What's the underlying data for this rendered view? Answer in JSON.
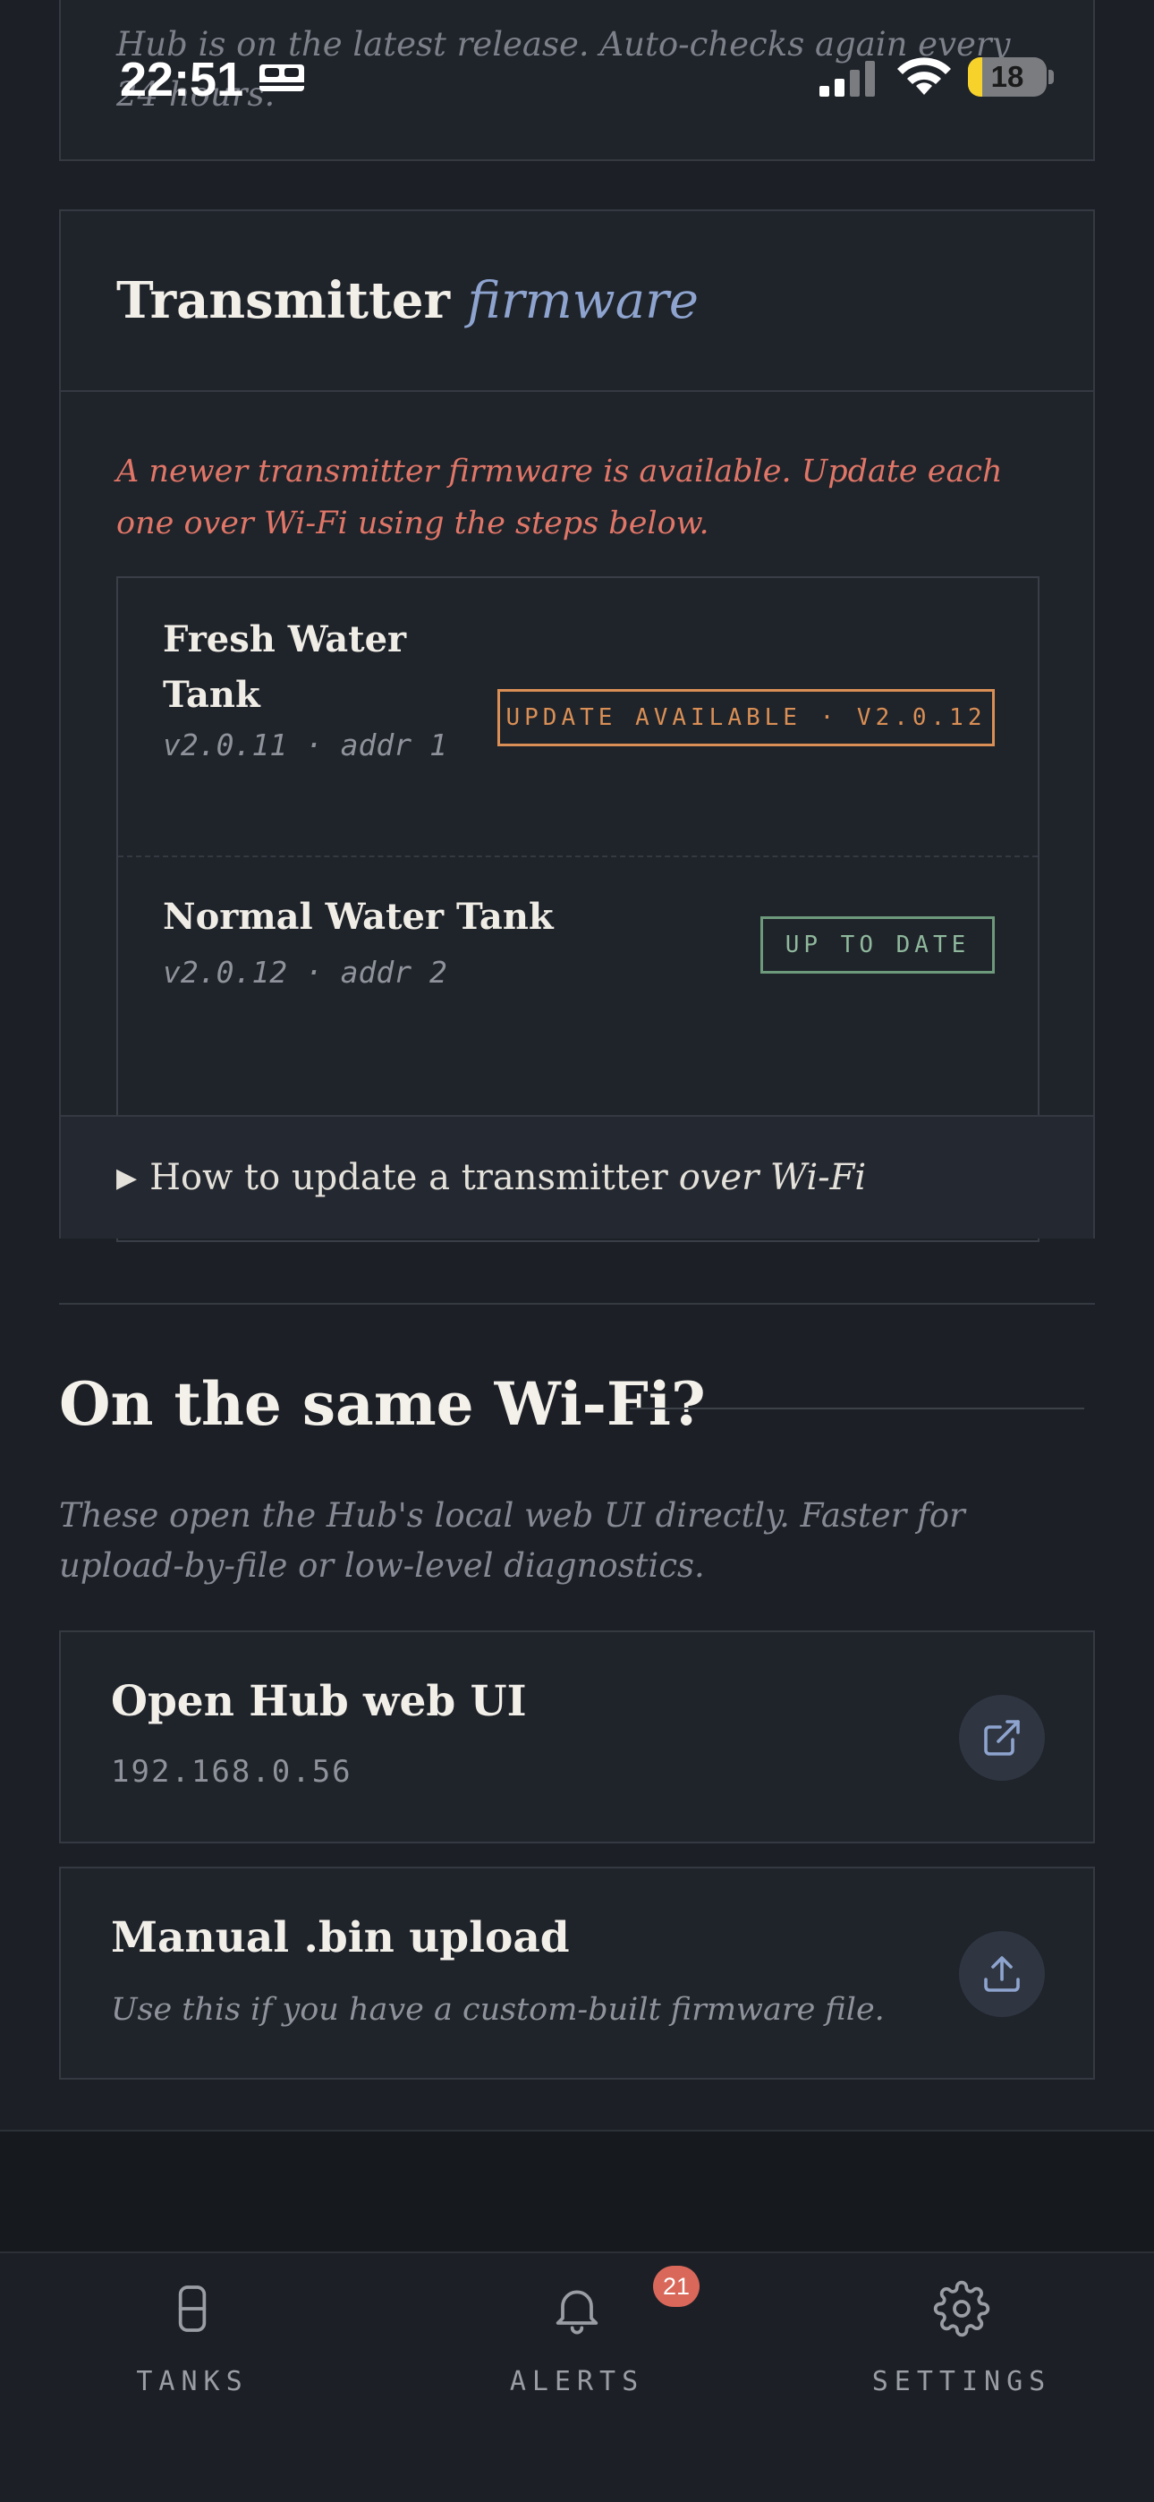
{
  "status_bar": {
    "time": "22:51",
    "battery": "18",
    "battery_level": 0.18
  },
  "hub_card": {
    "note": "Hub is on the latest release. Auto-checks again every 24 hours."
  },
  "transmitter_firmware": {
    "title_main": "Transmitter",
    "title_em": "firmware",
    "notice": "A newer transmitter firmware is available. Update each one over Wi-Fi using the steps below.",
    "transmitters": [
      {
        "name": "Fresh Water Tank",
        "meta": "v2.0.11 · addr 1",
        "status": "UPDATE AVAILABLE · V2.0.12"
      },
      {
        "name": "Normal Water Tank",
        "meta": "v2.0.12 · addr 2",
        "status": "UP TO DATE"
      }
    ],
    "howto_arrow": "▶",
    "howto_main": "How to update a transmitter",
    "howto_em": "over Wi-Fi"
  },
  "same_wifi": {
    "title": "On the same Wi-Fi?",
    "description": "These open the Hub's local web UI directly. Faster for upload-by-file or low-level diagnostics.",
    "open_hub": {
      "title": "Open Hub web UI",
      "address": "192.168.0.56",
      "icon": "external-link-icon"
    },
    "manual_upload": {
      "title": "Manual .bin upload",
      "subtitle": "Use this if you have a custom-built firmware file.",
      "icon": "upload-icon"
    }
  },
  "tabbar": {
    "tabs": [
      {
        "label": "TANKS",
        "icon": "tank-icon"
      },
      {
        "label": "ALERTS",
        "icon": "bell-icon"
      },
      {
        "label": "SETTINGS",
        "icon": "gear-icon"
      }
    ],
    "alerts_badge": "21"
  },
  "colors": {
    "background": "#1c2026",
    "accent_blue": "#8ea4cf",
    "warning_text": "#e07667",
    "update_badge": "#d98f55",
    "ok_badge": "#8fb89c",
    "alert_badge": "#d9685a"
  }
}
